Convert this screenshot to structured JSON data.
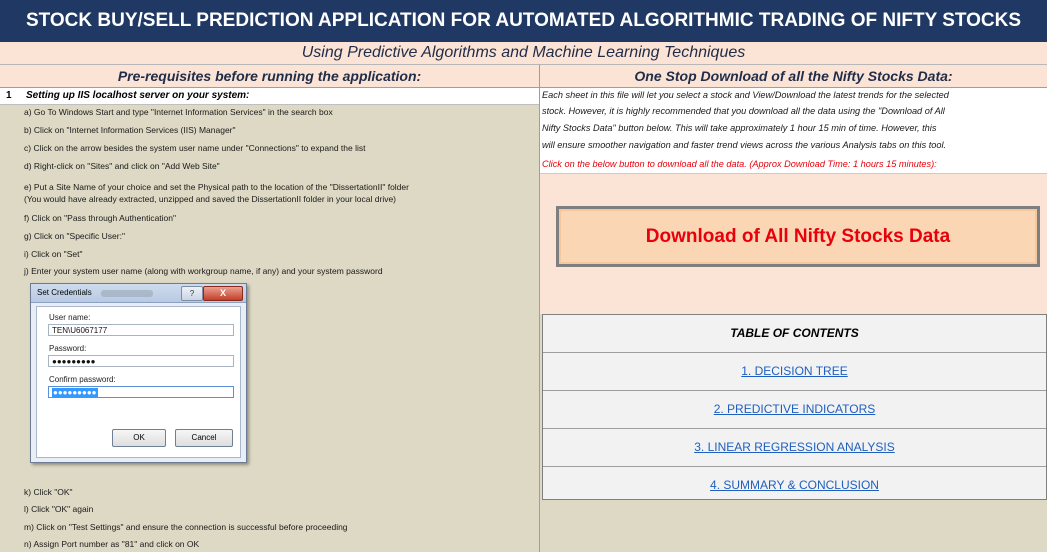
{
  "header": {
    "title": "STOCK BUY/SELL PREDICTION APPLICATION FOR AUTOMATED ALGORITHMIC TRADING OF NIFTY STOCKS",
    "subtitle": "Using Predictive Algorithms and Machine Learning Techniques"
  },
  "left": {
    "heading": "Pre-requisites before running the application:",
    "step_number": "1",
    "step_title": "Setting up IIS localhost server on your system:",
    "instructions": [
      "a) Go To Windows Start and type \"Internet Information Services\" in the search box",
      "b) Click on \"Internet Information Services (IIS) Manager\"",
      "c) Click on the arrow besides the system user name under \"Connections\" to expand the list",
      "d) Right-click on \"Sites\" and click on \"Add Web Site\"",
      "e) Put a Site Name of your choice and set the Physical path to the location of the \"DissertationII\" folder",
      "(You would have already extracted, unzipped and saved the DissertationII folder in your local drive)",
      "f) Click on \"Pass through Authentication\"",
      "g) Click on \"Specific User:\"",
      "i) Click on \"Set\"",
      "j) Enter your system user name (along with workgroup name, if any) and your system password",
      "k) Click \"OK\"",
      "l) Click \"OK\" again",
      "m) Click on \"Test Settings\" and ensure the connection is successful before proceeding",
      "n) Assign Port number as \"81\" and click on OK"
    ],
    "dialog": {
      "title": "Set Credentials",
      "help": "?",
      "close": "X",
      "username_label": "User name:",
      "username_value": "TEN\\U6067177",
      "password_label": "Password:",
      "password_value": "●●●●●●●●●",
      "confirm_label": "Confirm password:",
      "confirm_value": "●●●●●●●●●",
      "ok": "OK",
      "cancel": "Cancel"
    }
  },
  "right": {
    "heading": "One Stop Download of all the Nifty Stocks Data:",
    "description_lines": [
      "Each sheet in this file will let you select a stock and View/Download the latest trends for the selected",
      "stock. However, it is highly recommended that you download all the data using the \"Download of All",
      "Nifty Stocks Data\" button below. This will take approximately 1 hour 15 min of time. However, this",
      "will ensure smoother navigation and faster trend views across the various Analysis tabs on this tool."
    ],
    "red_note": "Click on the below button to download all the data. (Approx Download Time: 1 hours 15 minutes):",
    "download_button": "Download of All Nifty Stocks Data",
    "toc": {
      "heading": "TABLE OF CONTENTS",
      "items": [
        "1. DECISION TREE",
        "2. PREDICTIVE INDICATORS",
        "3. LINEAR REGRESSION ANALYSIS",
        "4. SUMMARY & CONCLUSION"
      ]
    }
  },
  "colors": {
    "banner": "#1f3864",
    "peach": "#fbe3d5",
    "panel": "#ddd9c4",
    "red_text": "#e8000b",
    "link": "#1f5fbf"
  }
}
